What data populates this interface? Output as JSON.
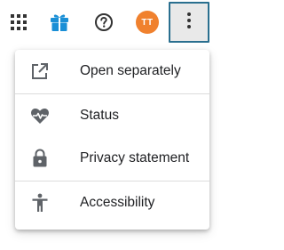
{
  "topbar": {
    "icons": {
      "apps": "apps-grid-icon",
      "gift": "gift-icon",
      "help": "help-circle-icon",
      "more": "more-vert-icon"
    },
    "avatar_initials": "TT",
    "avatar_color": "#f0812e",
    "gift_color": "#1a8fd6",
    "more_button_border_color": "#2a6f8f"
  },
  "menu": {
    "items": [
      {
        "label": "Open separately",
        "icon": "open-in-new-icon"
      },
      {
        "label": "Status",
        "icon": "heart-pulse-icon"
      },
      {
        "label": "Privacy statement",
        "icon": "lock-icon"
      },
      {
        "label": "Accessibility",
        "icon": "accessibility-icon"
      }
    ]
  }
}
